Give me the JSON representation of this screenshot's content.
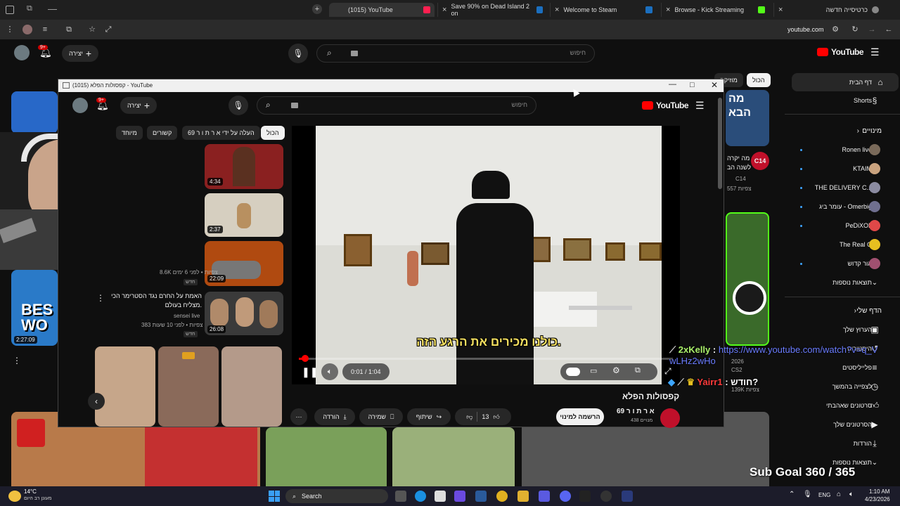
{
  "tabs": [
    {
      "title": "(1015) YouTube",
      "fav": "#ff0000",
      "active": true
    },
    {
      "title": "Save 90% on Dead Island 2 on",
      "fav": "#1b6fbf"
    },
    {
      "title": "Welcome to Steam",
      "fav": "#1b6fbf"
    },
    {
      "title": "Browse - Kick Streaming",
      "fav": "#53fc18"
    },
    {
      "title": "כרטיסייה חדשה",
      "fav": "#888888"
    }
  ],
  "address": {
    "url": "youtube.com"
  },
  "bg": {
    "search_placeholder": "חיפוש",
    "create_label": "יצירה",
    "notif_count": "9+",
    "chips": [
      "הכול",
      "מוזיקה"
    ],
    "logo_text": "YouTube"
  },
  "sidebar": {
    "home": "דף הבית",
    "shorts": "Shorts",
    "subs_header": "מינויים",
    "subs": [
      {
        "name": "Ronen live",
        "color": "#7a6a5a"
      },
      {
        "name": "KTAIM",
        "color": "#c9a27e"
      },
      {
        "name": "THE DELIVERY C...",
        "color": "#8a8aa0"
      },
      {
        "name": "עומר ביג - Omerbig",
        "color": "#6f6f8f"
      },
      {
        "name": "PeDiXOL",
        "color": "#e04848"
      },
      {
        "name": "The Real G",
        "color": "#e6c020"
      },
      {
        "name": "אור קדוש",
        "color": "#a05070"
      }
    ],
    "more": "תוצאות נוספות",
    "you_header": "הדף שלי",
    "you_items": [
      "הערוץ שלך",
      "היסטוריה",
      "פלייליסטים",
      "לצפייה בהמשך",
      "סרטונים שאהבתי",
      "הסרטונים שלך",
      "הורדות",
      "תוצאות נוספות"
    ]
  },
  "bg_video": {
    "channel_badge": "C14",
    "title_lines": [
      "מה יקרה",
      "לשנה הב"
    ],
    "channel": "C14",
    "views": "557 צפיות",
    "duration": "2:27:09",
    "best_text": "BES",
    "best_text2": "WO"
  },
  "window": {
    "title": "קפסולות הפלא (1015) - YouTube",
    "search_placeholder": "חיפוש",
    "create_label": "יצירה",
    "notif_count": "9+",
    "logo_text": "YouTube",
    "chips": [
      "הכול",
      "העלה על ידי א ר ת ו ר 69",
      "קשורים",
      "מיוחד"
    ]
  },
  "related": [
    {
      "duration": "4:34",
      "color": "#8a2020"
    },
    {
      "duration": "2:37",
      "color": "#d6cfc0"
    },
    {
      "duration": "22:09",
      "color": "#b04a10"
    },
    {
      "duration": "26:08",
      "color": "#3a3a3a"
    }
  ],
  "related_text": {
    "r3_views": "8.6K צפיות • לפני 6 ימים",
    "r3_badge": "חדש",
    "r4_title": "האמת על החרם נגד הסטרימר הכי מצליח בעולם.",
    "r4_channel": "sensei live",
    "r4_views": "383 צפיות • לפני 10 שעות",
    "r4_badge": "חדש"
  },
  "player": {
    "subtitle": "כולנו מכירים את הרגע הזה.",
    "time": "0:01 / 1:04",
    "progress": 0.016
  },
  "video": {
    "title": "קפסולות הפלא",
    "channel": "א ר ת ו ר 69",
    "subs": "438 מנויים",
    "subscribe": "הרשמה למינוי",
    "likes": "13",
    "share": "שיתוף",
    "save": "שמירה",
    "download": "הורדה"
  },
  "chat": [
    {
      "user": "2xKelly",
      "msg": "https://www.youtube.com/watch?v=q_VwLHz2wHo"
    },
    {
      "user": "Yairr1",
      "msg": "חודש?"
    }
  ],
  "sub_goal": "Sub Goal 360 / 365",
  "taskbar": {
    "temp": "14°C",
    "weather": "מעונן רב היום",
    "search": "Search",
    "lang": "ENG",
    "time": "1:10 AM",
    "date": "4/23/2026"
  },
  "misc_bg": {
    "side_views": "139K צפיות",
    "year": "2026",
    "cs2": "CS2"
  }
}
